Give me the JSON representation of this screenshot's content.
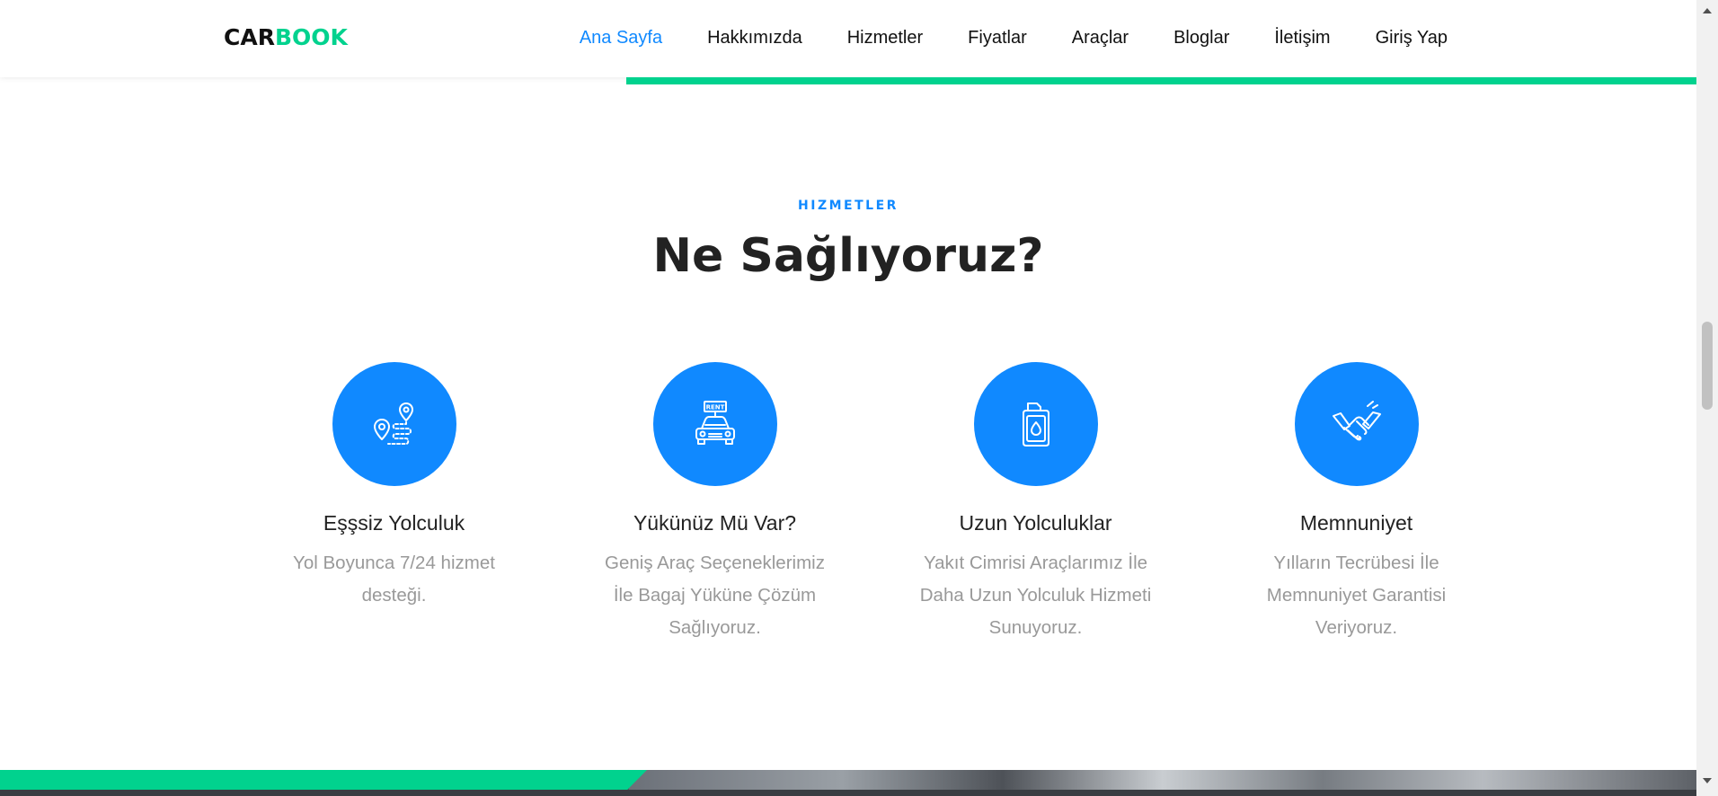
{
  "brand": {
    "part1": "CAR",
    "part2": "BOOK"
  },
  "nav": {
    "items": [
      {
        "label": "Ana Sayfa",
        "active": true
      },
      {
        "label": "Hakkımızda",
        "active": false
      },
      {
        "label": "Hizmetler",
        "active": false
      },
      {
        "label": "Fiyatlar",
        "active": false
      },
      {
        "label": "Araçlar",
        "active": false
      },
      {
        "label": "Bloglar",
        "active": false
      },
      {
        "label": "İletişim",
        "active": false
      },
      {
        "label": "Giriş Yap",
        "active": false
      }
    ]
  },
  "section": {
    "subheading": "HIZMETLER",
    "heading": "Ne Sağlıyoruz?"
  },
  "services": [
    {
      "icon": "route-pin-icon",
      "title": "Eşşsiz Yolculuk",
      "text": "Yol Boyunca 7/24 hizmet desteği."
    },
    {
      "icon": "rent-car-icon",
      "rent_label": "RENT",
      "title": "Yükünüz Mü Var?",
      "text": "Geniş Araç Seçeneklerimiz İle Bagaj Yüküne Çözüm Sağlıyoruz."
    },
    {
      "icon": "fuel-can-icon",
      "title": "Uzun Yolculuklar",
      "text": "Yakıt Cimrisi Araçlarımız İle Daha Uzun Yolculuk Hizmeti Sunuyoruz."
    },
    {
      "icon": "handshake-icon",
      "title": "Memnuniyet",
      "text": "Yılların Tecrübesi İle Memnuniyet Garantisi Veriyoruz."
    }
  ],
  "colors": {
    "accent_blue": "#1089ff",
    "accent_green": "#01d28e",
    "heading": "#222222",
    "muted_text": "#999999"
  }
}
